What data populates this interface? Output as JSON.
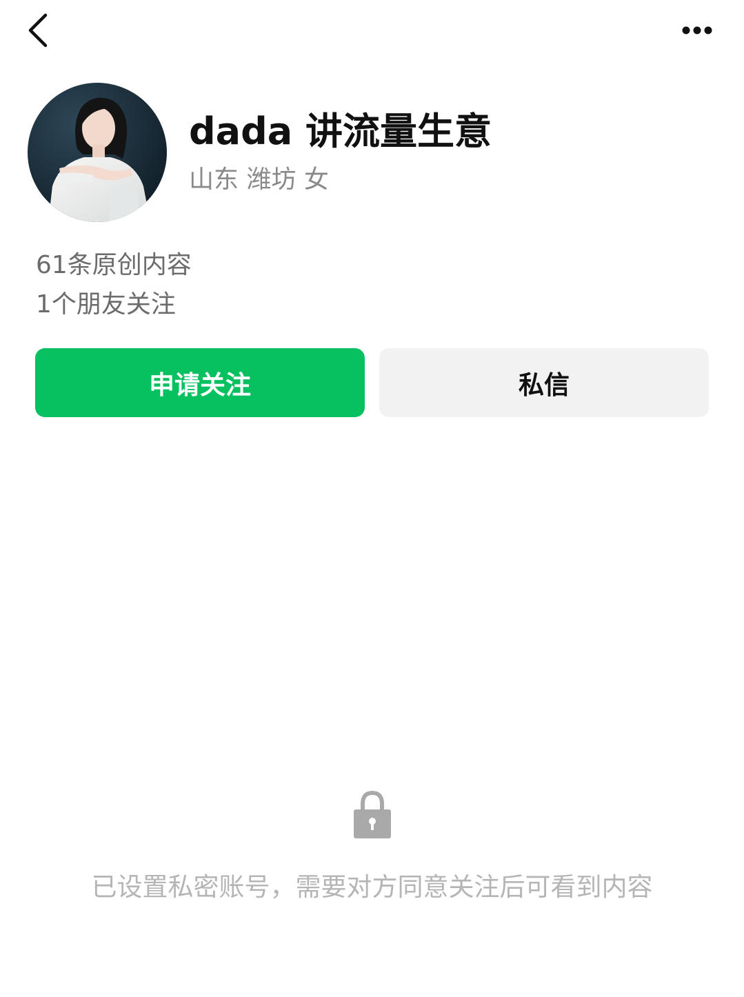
{
  "header": {
    "back_icon": "chevron-left-icon",
    "more_icon": "more-horizontal-icon"
  },
  "profile": {
    "avatar": "profile-photo-woman-white-shirt",
    "nickname": "dada 讲流量生意",
    "region": "山东 潍坊 女",
    "original_content": "61条原创内容",
    "friends_following": "1个朋友关注"
  },
  "actions": {
    "follow_label": "申请关注",
    "message_label": "私信",
    "follow_color": "#07c160",
    "message_bg": "#f2f2f2"
  },
  "privacy": {
    "lock_icon": "lock-icon",
    "note": "已设置私密账号，需要对方同意关注后可看到内容"
  }
}
